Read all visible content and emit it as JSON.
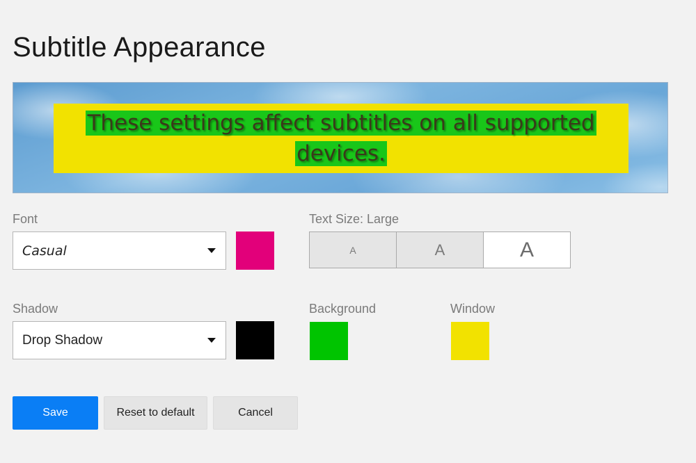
{
  "page": {
    "title": "Subtitle Appearance"
  },
  "preview": {
    "caption": "These settings affect subtitles on all supported devices."
  },
  "font": {
    "label": "Font",
    "value": "Casual",
    "color": "#e2007a"
  },
  "text_size": {
    "label": "Text Size: Large",
    "options": [
      "A",
      "A",
      "A"
    ],
    "selected": "Large"
  },
  "shadow": {
    "label": "Shadow",
    "value": "Drop Shadow",
    "color": "#000000"
  },
  "background": {
    "label": "Background",
    "color": "#00c400"
  },
  "window": {
    "label": "Window",
    "color": "#f2e200"
  },
  "actions": {
    "save": "Save",
    "reset": "Reset to default",
    "cancel": "Cancel"
  },
  "icons": {
    "dropdown": "chevron-down-icon"
  }
}
